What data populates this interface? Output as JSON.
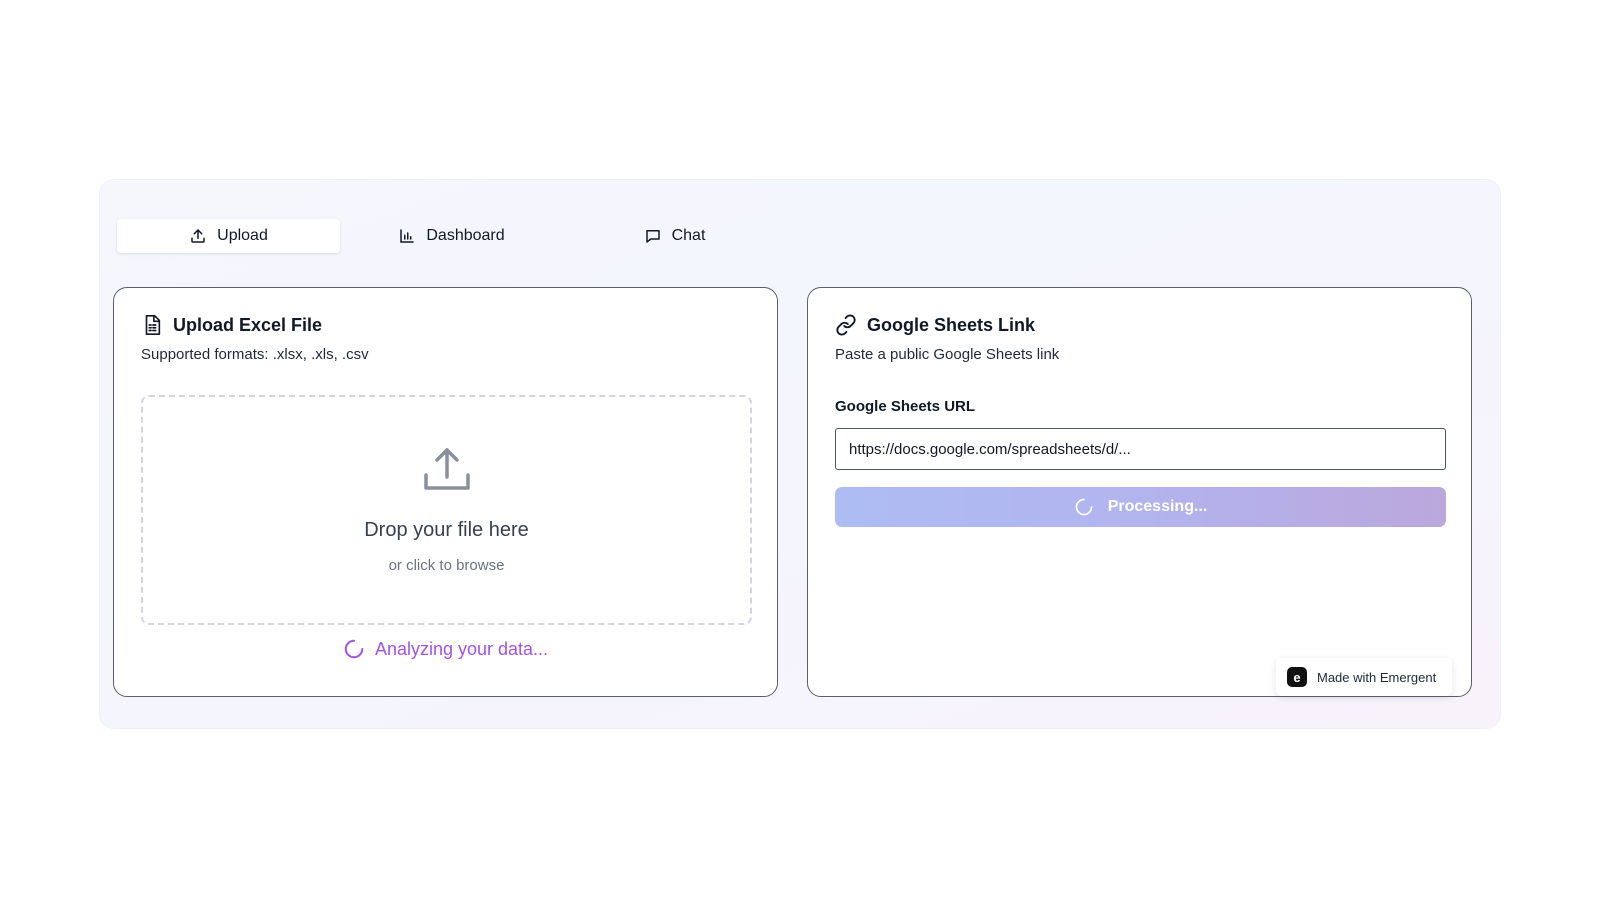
{
  "tabs": [
    {
      "label": "Upload",
      "icon": "upload-icon",
      "active": true
    },
    {
      "label": "Dashboard",
      "icon": "bar-chart-icon",
      "active": false
    },
    {
      "label": "Chat",
      "icon": "chat-bubble-icon",
      "active": false
    }
  ],
  "upload_card": {
    "title": "Upload Excel File",
    "subtitle": "Supported formats: .xlsx, .xls, .csv",
    "drop_title": "Drop your file here",
    "drop_sub": "or click to browse",
    "status": "Analyzing your data..."
  },
  "sheets_card": {
    "title": "Google Sheets Link",
    "subtitle": "Paste a public Google Sheets link",
    "url_label": "Google Sheets URL",
    "url_value": "https://docs.google.com/spreadsheets/d/...",
    "button_label": "Processing..."
  },
  "badge": {
    "logo": "e",
    "label": "Made with Emergent"
  },
  "colors": {
    "accent_purple": "#a452e6",
    "button_gradient_start": "#aebcf4",
    "button_gradient_end": "#bba7dc"
  }
}
